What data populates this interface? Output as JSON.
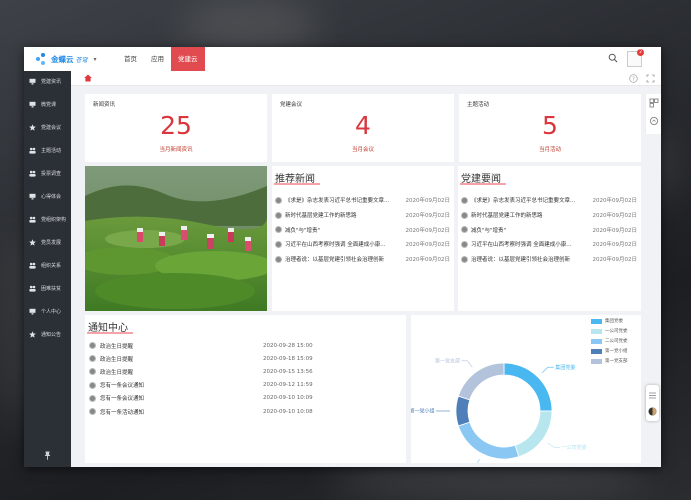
{
  "header": {
    "logo_text": "金蝶云",
    "logo_sub": "苍穹",
    "nav": [
      {
        "label": "首页"
      },
      {
        "label": "应用"
      },
      {
        "label": "党建云",
        "active": true
      }
    ],
    "notification_count": "2"
  },
  "sidebar": {
    "items": [
      {
        "label": "党建资讯",
        "icon": "monitor-icon"
      },
      {
        "label": "微党课",
        "icon": "monitor-icon"
      },
      {
        "label": "党建会议",
        "icon": "star-icon"
      },
      {
        "label": "主题活动",
        "icon": "group-icon"
      },
      {
        "label": "投票调查",
        "icon": "group-icon"
      },
      {
        "label": "心得体会",
        "icon": "monitor-icon"
      },
      {
        "label": "党组织架构",
        "icon": "group-icon"
      },
      {
        "label": "党员发展",
        "icon": "star-icon"
      },
      {
        "label": "组织关系",
        "icon": "group-icon"
      },
      {
        "label": "困难扶贫",
        "icon": "group-icon"
      },
      {
        "label": "个人中心",
        "icon": "monitor-icon"
      },
      {
        "label": "通知公告",
        "icon": "star-icon"
      }
    ]
  },
  "stats": [
    {
      "title": "新闻资讯",
      "value": "25",
      "label": "当月新闻资讯"
    },
    {
      "title": "党建会议",
      "value": "4",
      "label": "当月会议"
    },
    {
      "title": "主题活动",
      "value": "5",
      "label": "当月活动"
    }
  ],
  "recommended_news": {
    "title": "推荐新闻",
    "items": [
      {
        "text": "《求是》杂志发表习近平总书记重要文章...",
        "date": "2020年09月02日"
      },
      {
        "text": "新时代基层党建工作的新思路",
        "date": "2020年09月02日"
      },
      {
        "text": "减负\"与\"增责\"",
        "date": "2020年09月02日"
      },
      {
        "text": "习近平在山西考察时强调 全面建成小康...",
        "date": "2020年09月02日"
      },
      {
        "text": "治理者说：以基层党建引领社会治理创新",
        "date": "2020年09月02日"
      }
    ]
  },
  "party_news": {
    "title": "党建要闻",
    "items": [
      {
        "text": "《求是》杂志发表习近平总书记重要文章...",
        "date": "2020年09月02日"
      },
      {
        "text": "新时代基层党建工作的新思路",
        "date": "2020年09月02日"
      },
      {
        "text": "减负\"与\"增责\"",
        "date": "2020年09月02日"
      },
      {
        "text": "习近平在山西考察时强调 全面建成小康...",
        "date": "2020年09月02日"
      },
      {
        "text": "治理者说：以基层党建引领社会治理创新",
        "date": "2020年09月02日"
      }
    ]
  },
  "notices": {
    "title": "通知中心",
    "items": [
      {
        "text": "政治生日提醒",
        "date": "2020-09-28 15:00"
      },
      {
        "text": "政治生日提醒",
        "date": "2020-09-18 15:09"
      },
      {
        "text": "政治生日提醒",
        "date": "2020-09-15 13:56"
      },
      {
        "text": "您有一条会议通知",
        "date": "2020-09-12 11:59"
      },
      {
        "text": "您有一条会议通知",
        "date": "2020-09-10 10:09"
      },
      {
        "text": "您有一条活动通知",
        "date": "2020-09-10 10:08"
      }
    ]
  },
  "chart_data": {
    "type": "pie",
    "variant": "donut",
    "legend_position": "right",
    "categories": [
      "集团党委",
      "一公司党委",
      "二公司党委",
      "第一党小组",
      "第一党支部"
    ],
    "values": [
      25,
      20,
      25,
      10,
      20
    ],
    "colors": [
      "#4ab8f0",
      "#b7e6ef",
      "#8ac7f2",
      "#4f7fb8",
      "#b3c3dc"
    ],
    "slice_labels": [
      "集团党委",
      "一公司党委",
      "二公司党委",
      "第一党小组",
      "第一党支部"
    ]
  }
}
